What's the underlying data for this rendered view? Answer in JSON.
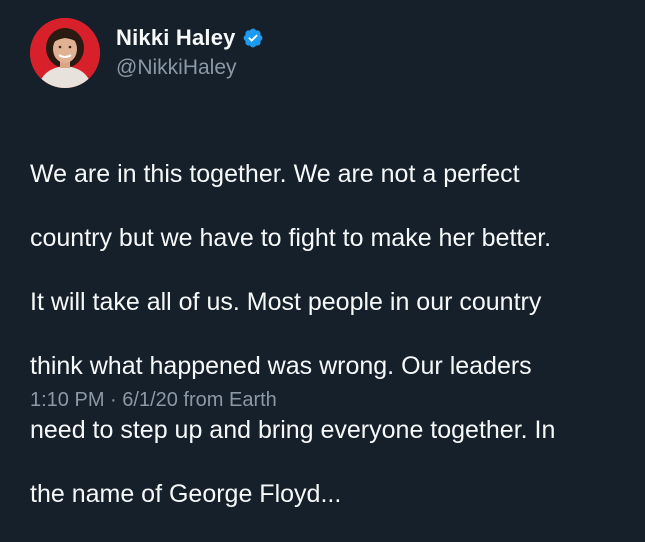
{
  "author": {
    "display_name": "Nikki Haley",
    "handle": "@NikkiHaley",
    "verified_icon": "verified-badge-icon",
    "avatar_bg": "#d8202a"
  },
  "tweet": {
    "lines": [
      "We are in this together. We are not a perfect",
      "country but we have to fight to make her better.",
      "It will take all of us. Most people in our country",
      "think what happened was wrong. Our leaders",
      "need to step up and bring everyone together. In",
      "the name of George Floyd..."
    ]
  },
  "meta": {
    "time": "1:10 PM",
    "separator": " · ",
    "date": "6/1/20",
    "source": " from Earth"
  },
  "colors": {
    "background": "#15202b",
    "text": "#f7f9f9",
    "secondary": "#8b98a5",
    "verified": "#1d9bf0"
  }
}
